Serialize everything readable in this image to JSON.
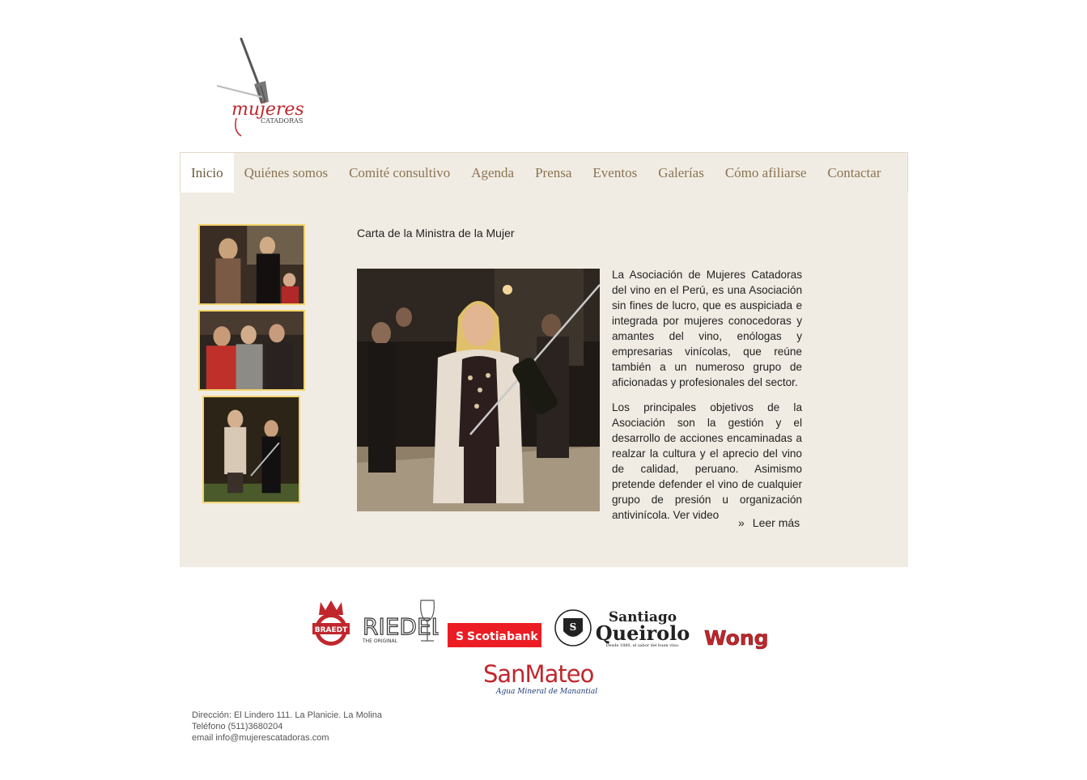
{
  "logo": {
    "script_text": "mujeres",
    "small_text": "CATADORAS"
  },
  "nav": {
    "items": [
      {
        "label": "Inicio",
        "active": true
      },
      {
        "label": "Quiénes somos"
      },
      {
        "label": "Comité consultivo"
      },
      {
        "label": "Agenda"
      },
      {
        "label": "Prensa"
      },
      {
        "label": "Eventos"
      },
      {
        "label": "Galerías"
      },
      {
        "label": "Cómo afiliarse"
      },
      {
        "label": "Contactar"
      }
    ]
  },
  "main": {
    "heading": "Carta de la Ministra de la Mujer",
    "paragraphs": [
      "La Asociación de Mujeres Catadoras del vino en el Perú, es una Asociación sin fines de lucro, que es auspiciada e integrada por mujeres conocedoras y amantes del vino, enólogas y empresarias vinícolas, que reúne también a un numeroso grupo de aficionadas y profesionales del sector.",
      "Los principales objetivos de la Asociación son la gestión y el desarrollo de acciones encaminadas a realzar la cultura y el aprecio del vino de calidad, peruano. Asimismo pretende defender el vino de cualquier grupo de presión u organización antivinícola. Ver video"
    ],
    "read_more_arrow": "»",
    "read_more": "Leer más"
  },
  "sponsors": {
    "braedt": "BRAEDT",
    "riedel": "RIEDEL",
    "riedel_sub": "THE ORIGINAL",
    "scotiabank": "Scotiabank",
    "queirolo_top": "Santiago",
    "queirolo_main": "Queirolo",
    "queirolo_sub": "Desde 1880, el sabor del buen vino.",
    "wong": "Wong",
    "sanmateo": "SanMateo",
    "sanmateo_sub": "Agua Mineral de Manantial"
  },
  "footer": {
    "address": "Dirección: El Lindero 111. La Planicie. La Molina",
    "phone": "Teléfono (511)3680204",
    "email": "email info@mujerescatadoras.com"
  },
  "colors": {
    "nav_text": "#8b7352",
    "panel_bg": "#f1ece3",
    "thumb_border": "#f2d36b",
    "brand_red": "#c0272d"
  }
}
